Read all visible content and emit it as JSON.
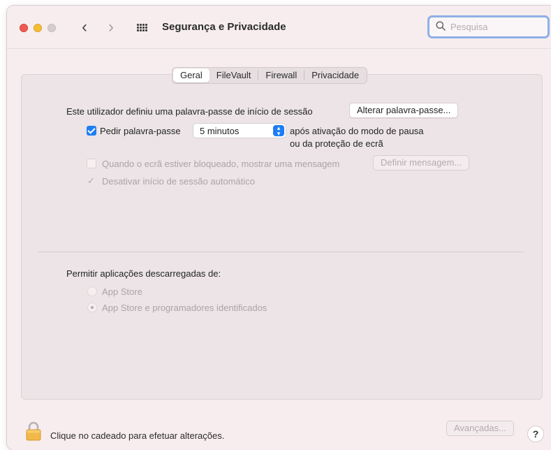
{
  "window": {
    "title": "Segurança e Privacidade"
  },
  "search": {
    "placeholder": "Pesquisa",
    "value": ""
  },
  "tabs": [
    {
      "label": "Geral",
      "selected": true
    },
    {
      "label": "FileVault",
      "selected": false
    },
    {
      "label": "Firewall",
      "selected": false
    },
    {
      "label": "Privacidade",
      "selected": false
    }
  ],
  "general": {
    "password_label": "Este utilizador definiu uma palavra-passe de início de sessão",
    "change_password_button": "Alterar palavra-passe...",
    "require_password_label": "Pedir palavra-passe",
    "require_password_checked": true,
    "require_password_delay": "5 minutos",
    "after_sleep_line1": "após ativação do modo de pausa",
    "after_sleep_line2": "ou da proteção de ecrã",
    "show_message_label": "Quando o ecrã estiver bloqueado, mostrar uma mensagem",
    "show_message_checked": false,
    "set_message_button": "Definir mensagem...",
    "disable_autologin_label": "Desativar início de sessão automático",
    "disable_autologin_checked": true
  },
  "downloads": {
    "heading": "Permitir aplicações descarregadas de:",
    "options": [
      {
        "label": "App Store",
        "selected": false
      },
      {
        "label": "App Store e programadores identificados",
        "selected": true
      }
    ]
  },
  "footer": {
    "lock_text": "Clique no cadeado para efetuar alterações.",
    "advanced_button": "Avançadas...",
    "help_label": "?"
  },
  "colors": {
    "accent": "#1d7ef5",
    "window_bg": "#f7edef",
    "panel_bg": "#ece4e6",
    "disabled_text": "#aca3a5",
    "close": "#ee5b53",
    "minimize": "#f5bd33"
  }
}
